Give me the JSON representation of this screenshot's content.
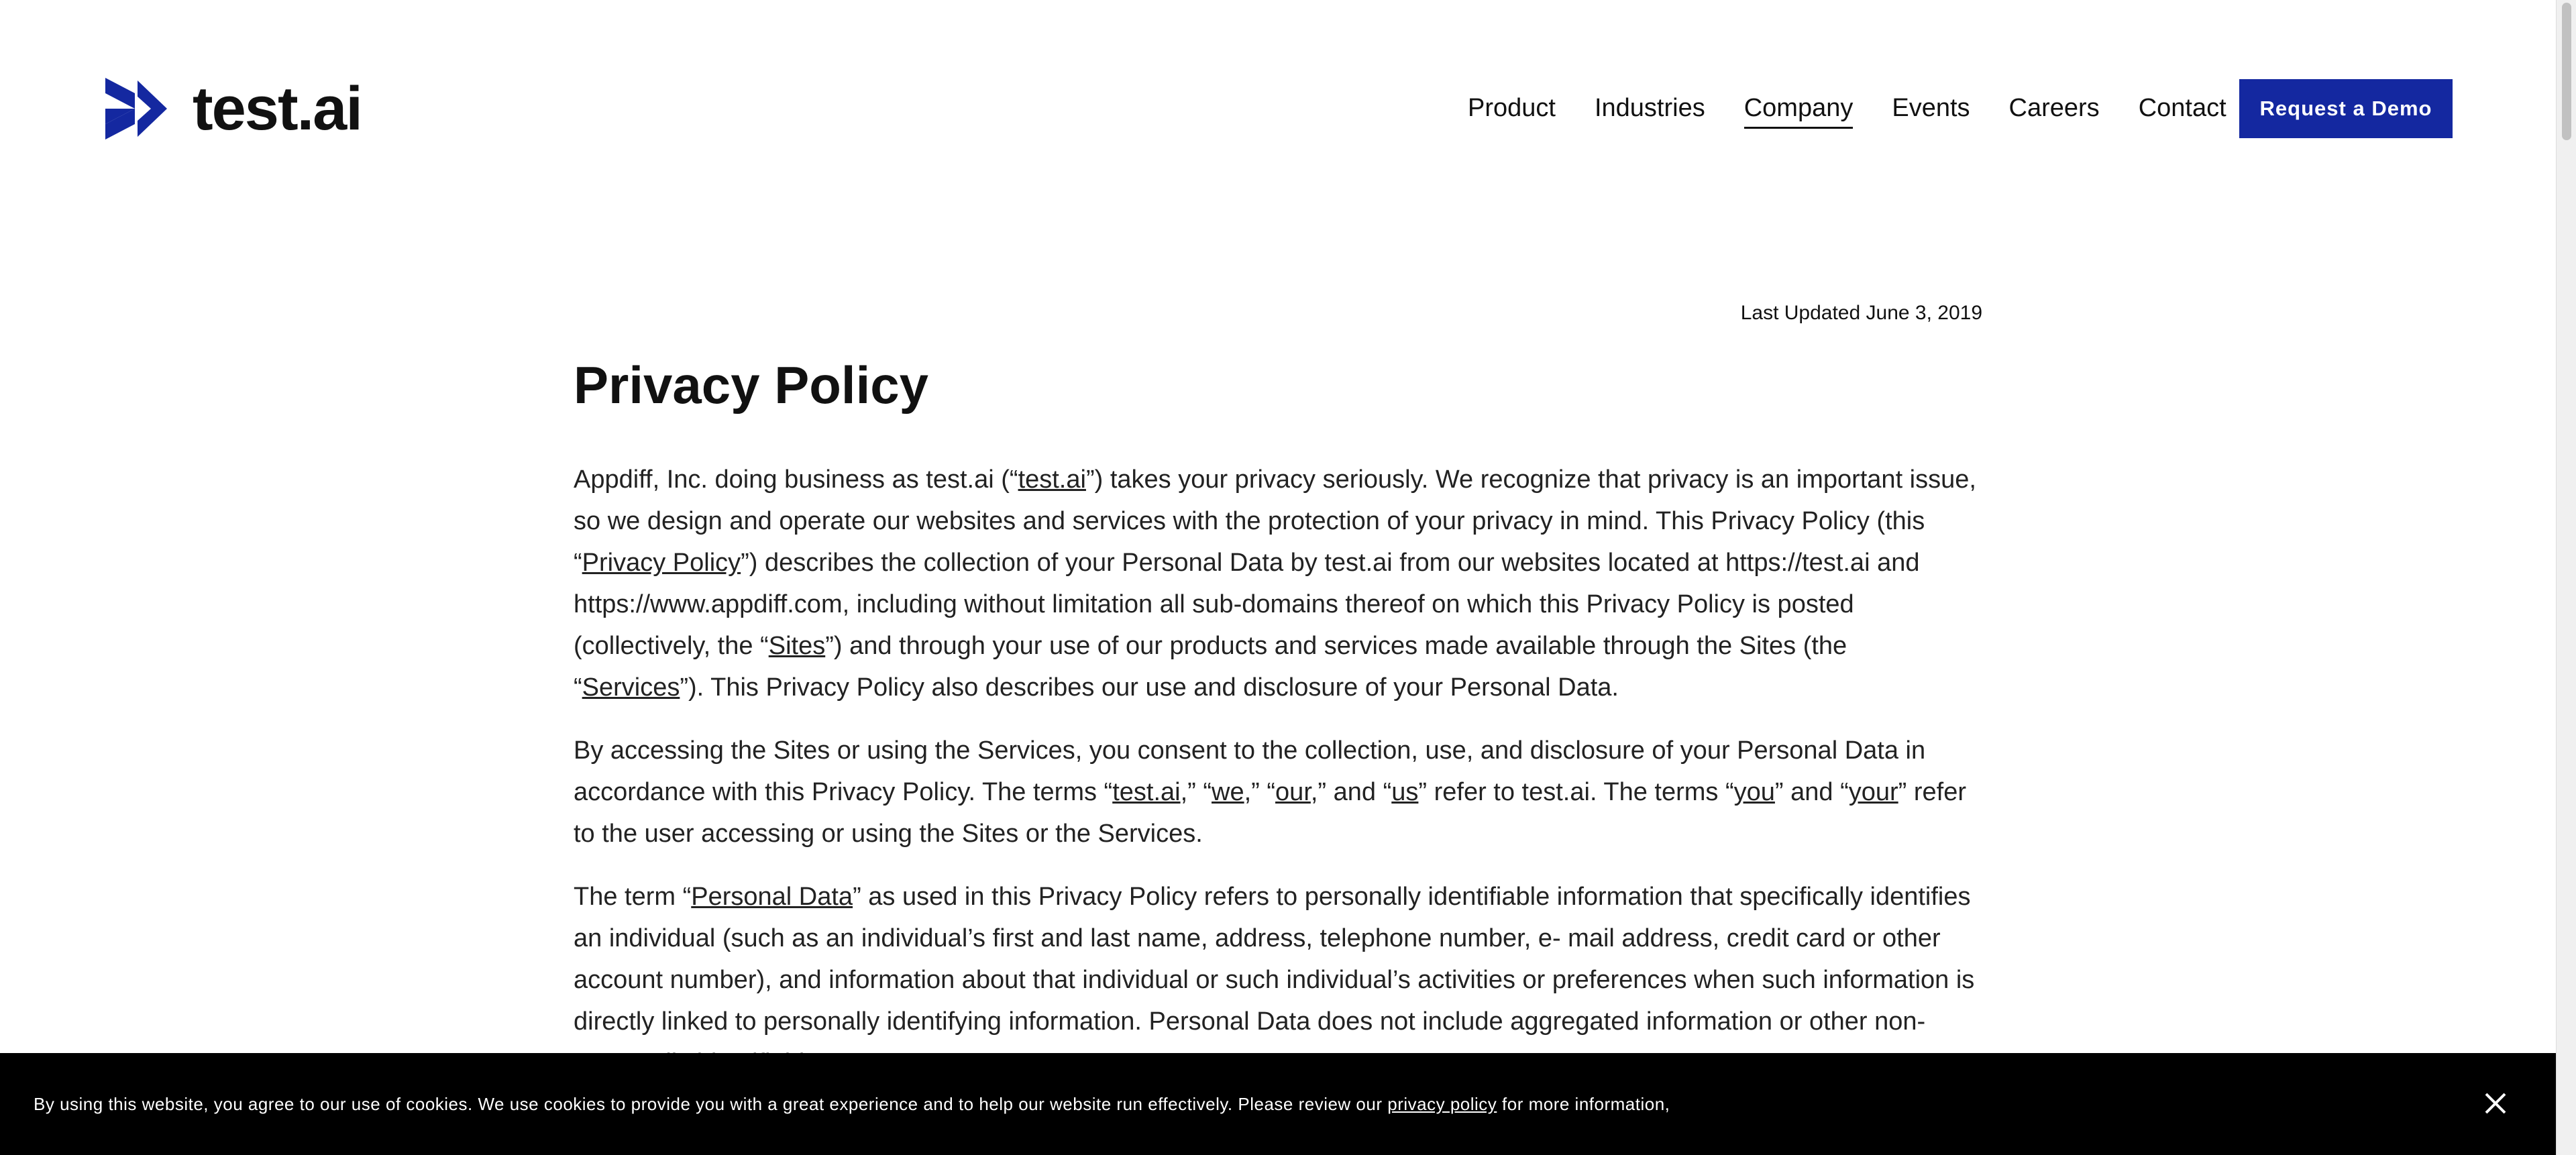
{
  "header": {
    "logo_text": "test.ai",
    "nav": [
      {
        "label": "Product"
      },
      {
        "label": "Industries"
      },
      {
        "label": "Company",
        "active": true
      },
      {
        "label": "Events"
      },
      {
        "label": "Careers"
      },
      {
        "label": "Contact"
      }
    ],
    "cta_label": "Request a Demo"
  },
  "main": {
    "last_updated": "Last Updated June 3, 2019",
    "title": "Privacy Policy",
    "p1": [
      "Appdiff, Inc. doing business as test.ai (“",
      "test.ai",
      "”) takes your privacy seriously. We recognize that privacy is an important issue, so we design and operate our websites and services with the protection of your privacy in mind. This Privacy Policy (this “",
      "Privacy Policy",
      "”) describes the collection of your Personal Data by test.ai from our websites located at https://test.ai and https://www.appdiff.com, including without limitation all sub-domains thereof on which this Privacy Policy is posted (collectively, the “",
      "Sites",
      "”) and through your use of our products and services made available through the Sites (the “",
      "Services",
      "”).  This Privacy Policy also describes our use and disclosure of your Personal Data."
    ],
    "p2": [
      "By accessing the Sites or using the Services, you consent to the collection, use, and disclosure of your Personal Data in accordance with this Privacy Policy.  The terms “",
      "test.ai",
      ",” “",
      "we",
      ",” “",
      "our",
      ",” and “",
      "us",
      "” refer to test.ai. The terms “",
      "you",
      "” and “",
      "your",
      "” refer to the user accessing or using the Sites or the Services."
    ],
    "p3": [
      "The term “",
      "Personal Data",
      "” as used in this Privacy Policy refers to personally identifiable information that specifically identifies an individual (such as an individual’s first and last name, address, telephone number, e- mail address, credit card or other account number), and information about that individual or such individual’s activities or preferences when such information is directly linked to personally identifying information.  Personal Data does not include aggregated information or other non-personally identifiable"
    ]
  },
  "cookie": {
    "text": "By using this website, you agree to our use of cookies. We use cookies to provide you with a great experience and to help our website run effectively. Please review our ",
    "link": "privacy policy",
    "text_after": " for more information,"
  },
  "colors": {
    "brand_blue": "#1428a0",
    "cookie_bg": "#000000"
  },
  "icons": [
    "logo-chevron-icon",
    "close-icon"
  ]
}
